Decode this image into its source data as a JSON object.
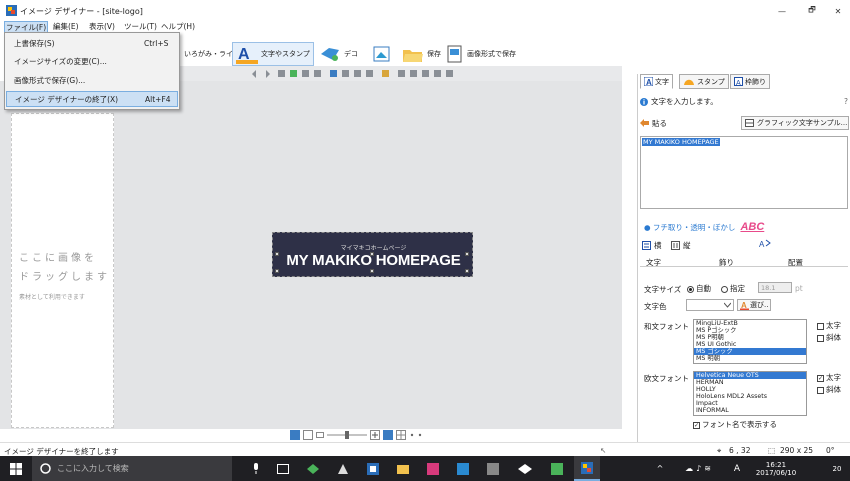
{
  "window": {
    "title": "イメージ デザイナー - [site-logo]",
    "minimize": "—",
    "maximize": "🗗",
    "close": "✕"
  },
  "menubar": [
    "ファイル(F)",
    "編集(E)",
    "表示(V)",
    "ツール(T)",
    "ヘルプ(H)"
  ],
  "file_menu": [
    {
      "label": "上書保存(S)",
      "shortcut": "Ctrl+S"
    },
    {
      "label": "イメージサイズの変更(C)...",
      "shortcut": ""
    },
    {
      "label": "画像形式で保存(G)...",
      "shortcut": ""
    },
    {
      "label": "イメージ デザイナーの終了(X)",
      "shortcut": "Alt+F4"
    }
  ],
  "toolbar": {
    "iroiro_line": "いろがみ・ライン",
    "text_stamp": "文字やスタンプ",
    "deco": "デコ",
    "save": "保存",
    "save_image": "画像形式で保存"
  },
  "left_panel": {
    "drop_line1": "ここに画像を",
    "drop_line2": "ドラッグします",
    "material_note": "素材として利用できます"
  },
  "logo": {
    "subtitle": "マイマキコホームページ",
    "title": "MY MAKIKO HOMEPAGE"
  },
  "right_panel": {
    "tabs": {
      "moji": "文字",
      "stamp": "スタンプ",
      "waku": "枠飾り"
    },
    "info": "文字を入力します。",
    "help": "?",
    "paste_button": "貼る",
    "graphic_sample": "グラフィック文字サンプル...",
    "text_input_value": "MY MAKIKO HOMEPAGE",
    "effect_label": "● フチ取り・透明・ぼかし",
    "effect_sample": "ABC",
    "horizontal": "横",
    "vertical": "縦",
    "sub_tabs": {
      "moji": "文字",
      "waku": "飾り",
      "layout": "配置"
    },
    "font_size_label": "文字サイズ",
    "size_auto": "自動",
    "size_fixed": "指定",
    "size_value": "18.1",
    "size_unit": "pt",
    "color_label": "文字色",
    "color_pick_button": "選び..",
    "japanese_font_label": "和文フォント",
    "japanese_fonts": [
      "MingLiU-ExtB",
      "MS Pゴシック",
      "MS P明朝",
      "MS UI Gothic",
      "MS ゴシック",
      "MS 明朝"
    ],
    "japanese_font_selected": 4,
    "bold": "太字",
    "italic": "斜体",
    "western_font_label": "欧文フォント",
    "western_fonts": [
      "Helvetica Neue OTS",
      "HERMAN",
      "HOLLY",
      "HoloLens MDL2 Assets",
      "Impact",
      "INFORMAL"
    ],
    "western_font_selected": 0,
    "show_font_name": "フォント名で表示する"
  },
  "status": {
    "message": "イメージ デザイナーを終了します",
    "position": "6 , 32",
    "size": "290 x 25",
    "angle": "0°"
  },
  "taskbar": {
    "search_placeholder": "ここに入力して検索",
    "time": "16:21",
    "date": "2017/06/10",
    "ime": "A",
    "notif_count": "20"
  }
}
